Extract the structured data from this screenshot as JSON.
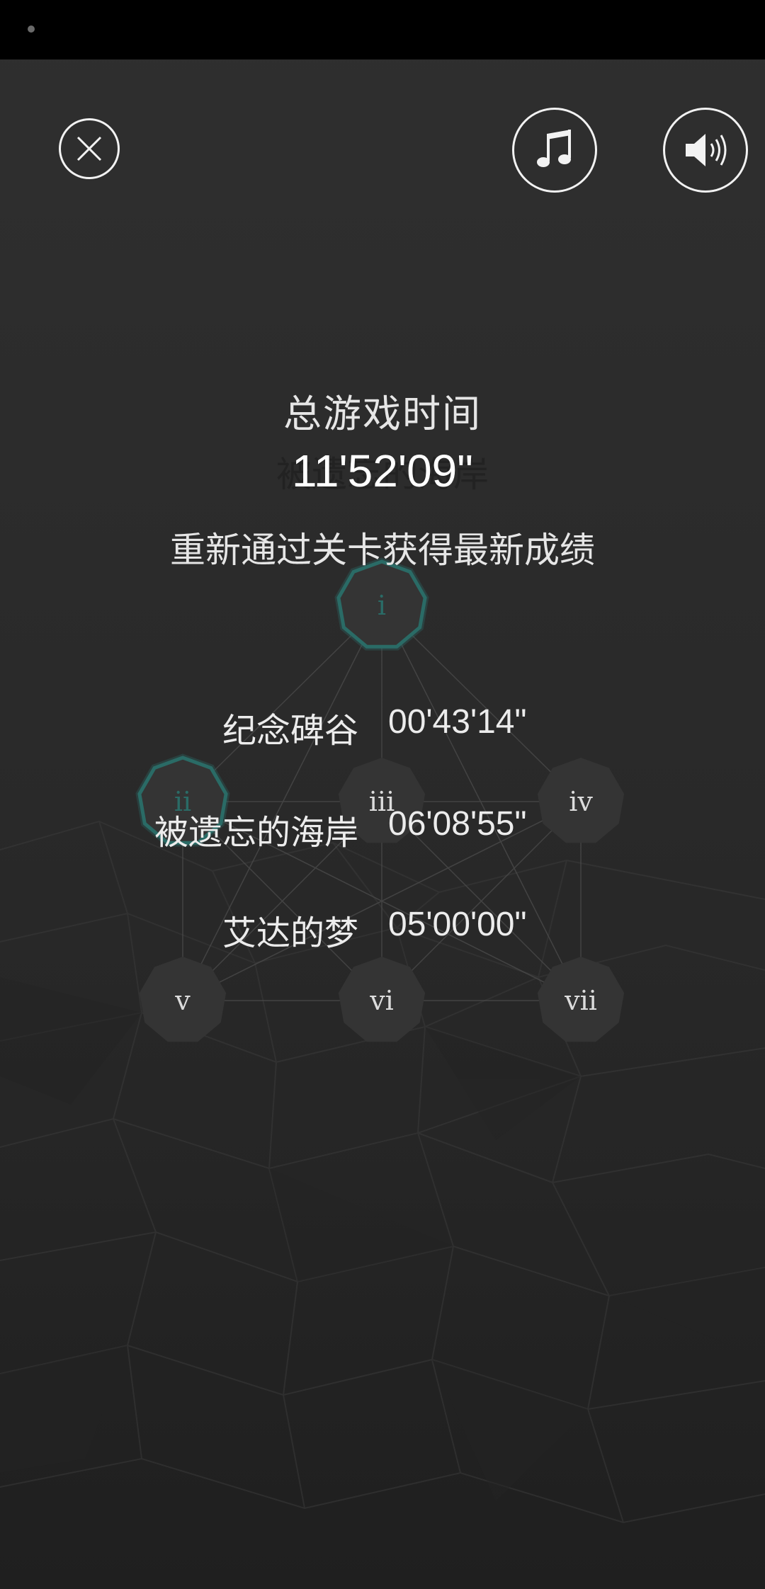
{
  "header": {
    "close_icon": "close-icon",
    "music_icon": "music-note-icon",
    "sound_icon": "speaker-icon"
  },
  "background_subtitle": "被遗忘的海岸",
  "summary": {
    "total_label": "总游戏时间",
    "total_time": "11'52'09\"",
    "retry_note": "重新通过关卡获得最新成绩"
  },
  "records": [
    {
      "name": "纪念碑谷",
      "time": "00'43'14\""
    },
    {
      "name": "被遗忘的海岸",
      "time": "06'08'55\""
    },
    {
      "name": "艾达的梦",
      "time": "05'00'00\""
    }
  ],
  "level_nodes": [
    {
      "label": "i",
      "state": "active"
    },
    {
      "label": "ii",
      "state": "active"
    },
    {
      "label": "iii",
      "state": "locked"
    },
    {
      "label": "iv",
      "state": "locked"
    },
    {
      "label": "v",
      "state": "locked"
    },
    {
      "label": "vi",
      "state": "locked"
    },
    {
      "label": "vii",
      "state": "locked"
    }
  ],
  "colors": {
    "accent": "#2a6b66",
    "node_fill": "#343434",
    "text": "#e8e8e8"
  }
}
